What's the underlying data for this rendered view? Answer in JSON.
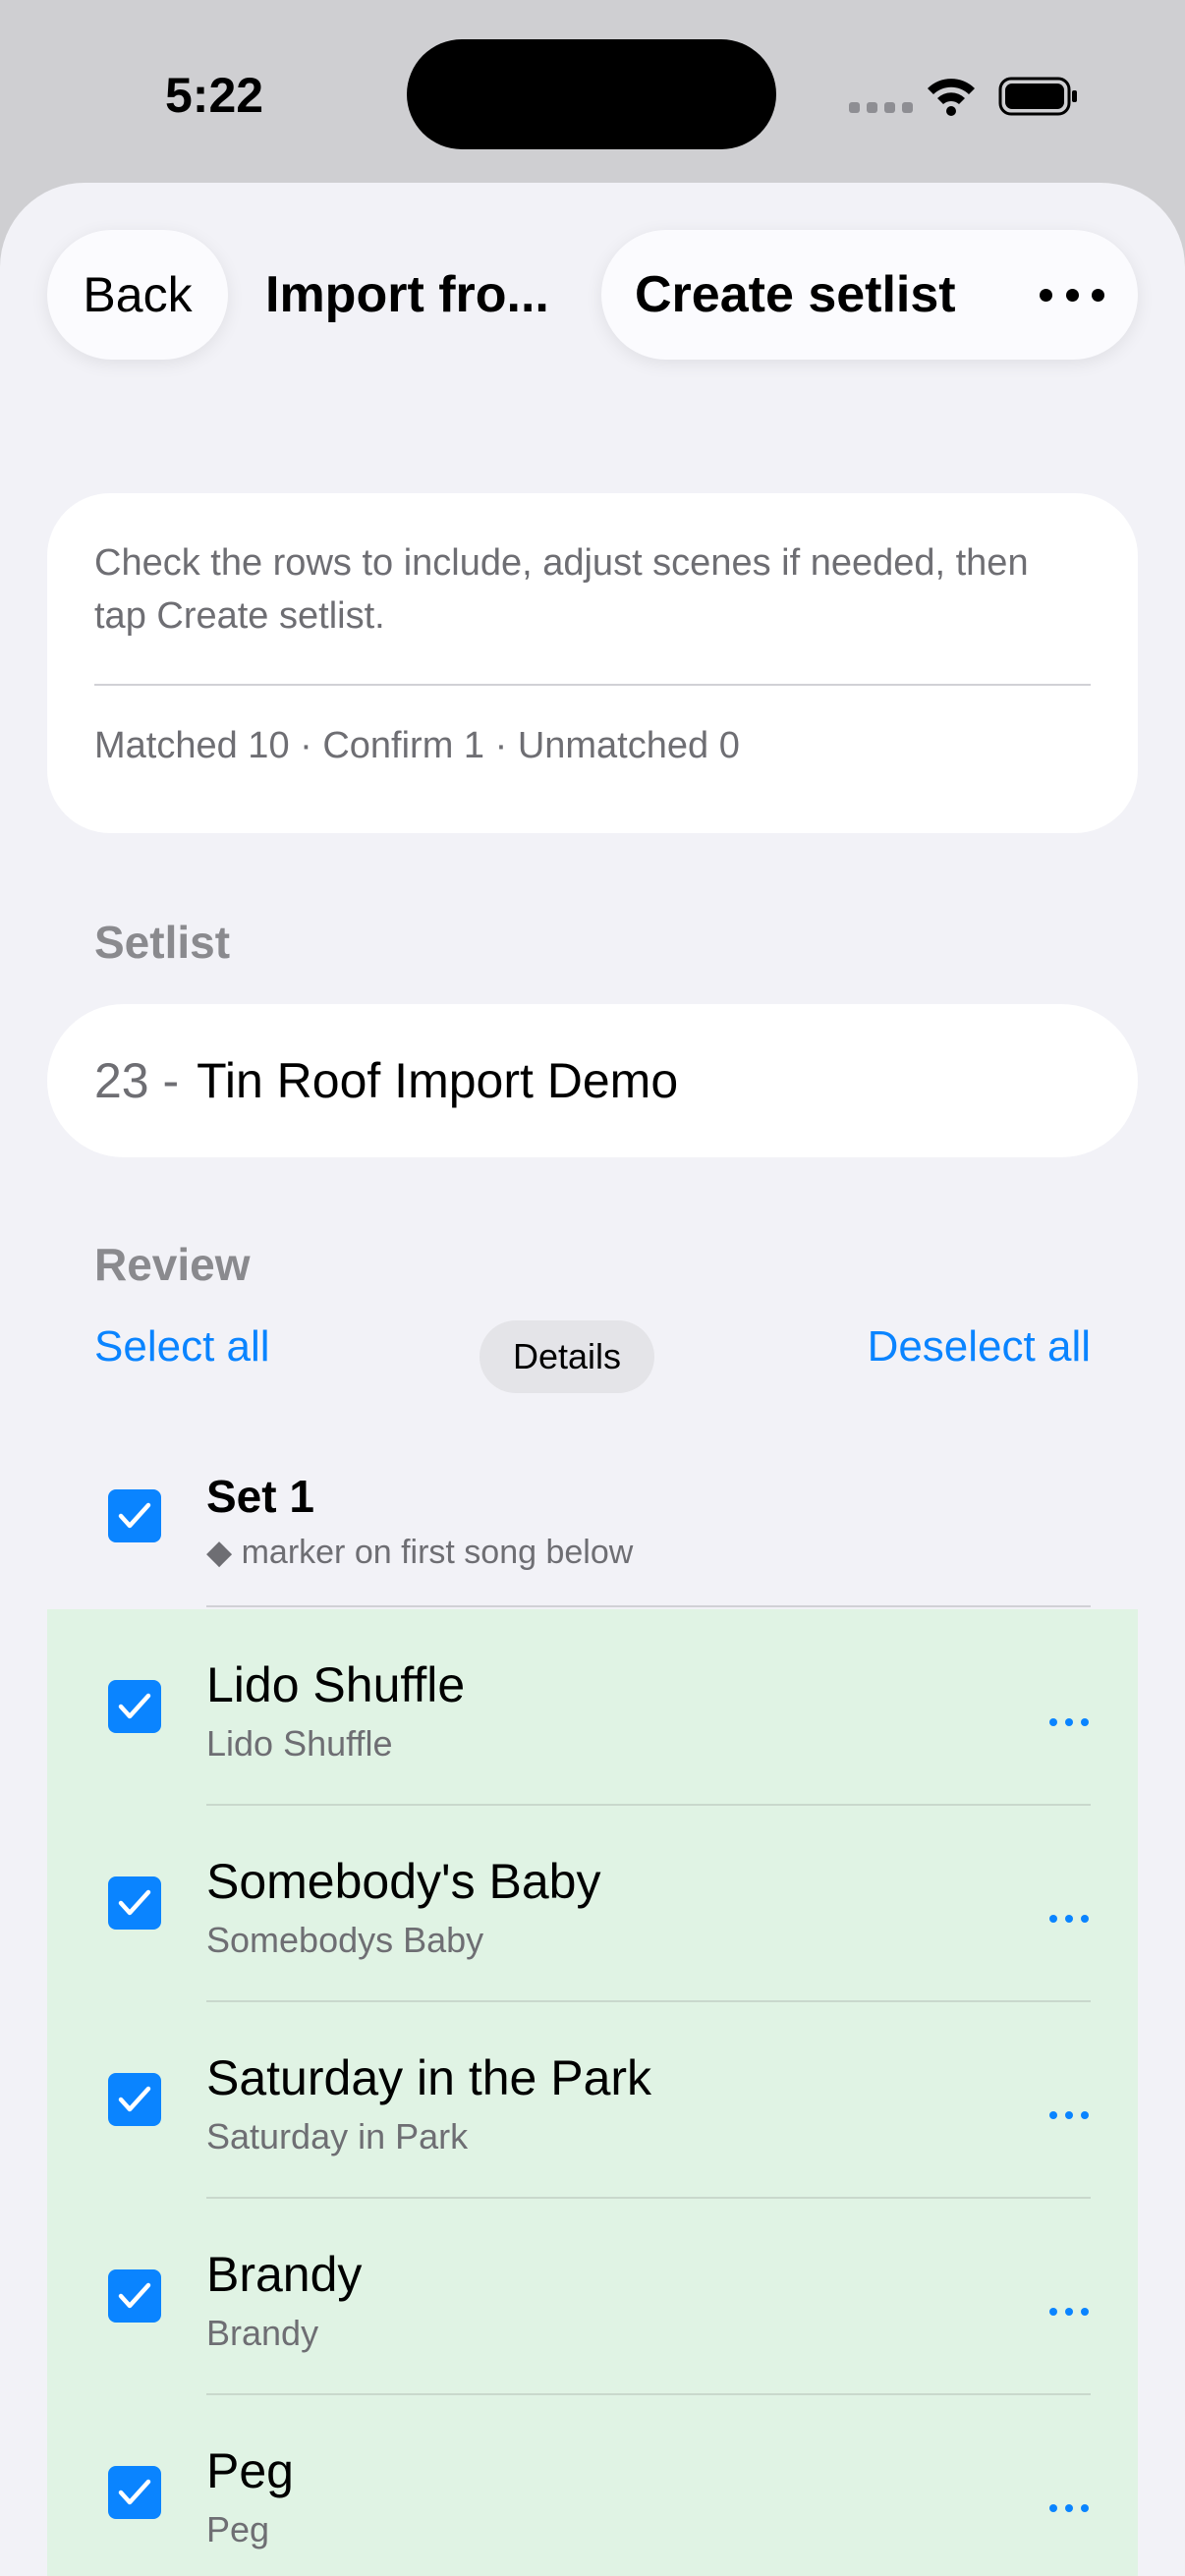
{
  "status_bar": {
    "time": "5:22"
  },
  "nav": {
    "back_label": "Back",
    "title": "Import fro...",
    "create_label": "Create setlist",
    "more_icon": "ellipsis-icon"
  },
  "info": {
    "text": "Check the rows to include, adjust scenes if needed, then tap Create setlist.",
    "stats": "Matched 10 · Confirm 1 · Unmatched 0"
  },
  "setlist": {
    "section_label": "Setlist",
    "number": "23 -",
    "name": "Tin Roof Import Demo"
  },
  "review": {
    "section_label": "Review",
    "select_all": "Select all",
    "details": "Details",
    "deselect_all": "Deselect all",
    "set": {
      "title": "Set 1",
      "subtitle": "◆ marker on first song below",
      "checked": true
    },
    "rows": [
      {
        "title": "Lido Shuffle",
        "subtitle": "Lido Shuffle",
        "checked": true
      },
      {
        "title": "Somebody's Baby",
        "subtitle": "Somebodys Baby",
        "checked": true
      },
      {
        "title": "Saturday in the Park",
        "subtitle": "Saturday in Park",
        "checked": true
      },
      {
        "title": "Brandy",
        "subtitle": "Brandy",
        "checked": true
      },
      {
        "title": "Peg",
        "subtitle": "Peg",
        "checked": true
      }
    ]
  },
  "colors": {
    "accent": "#0a84ff",
    "matched_bg": "#e0f3e4",
    "sheet_bg": "#f2f2f7"
  }
}
